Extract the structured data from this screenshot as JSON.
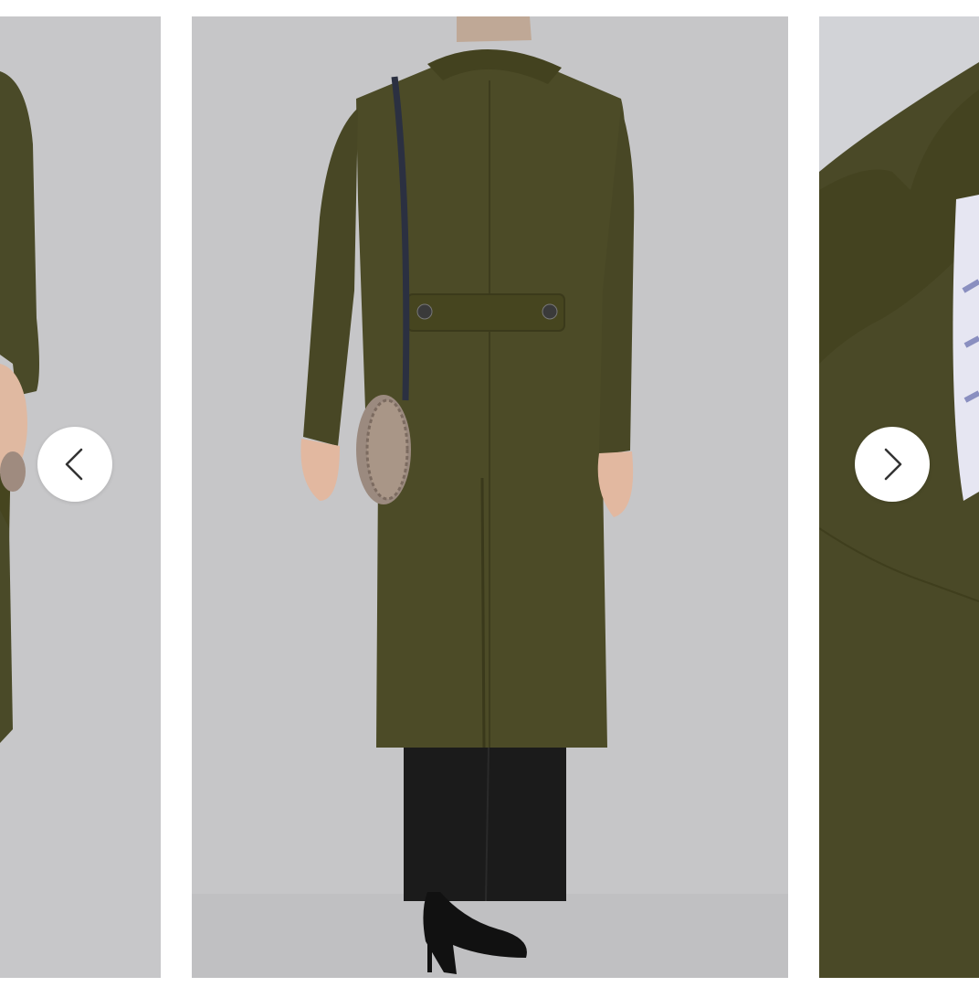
{
  "carousel": {
    "slides": [
      {
        "name": "previous-slide",
        "description_icon": "product-photo"
      },
      {
        "name": "current-slide",
        "description_icon": "product-photo"
      },
      {
        "name": "next-slide",
        "description_icon": "product-photo"
      }
    ],
    "prev_button": {
      "icon": "chevron-left-icon"
    },
    "next_button": {
      "icon": "chevron-right-icon"
    }
  },
  "colors": {
    "background": "#ffffff",
    "coat": "#4b4a28",
    "photo_backdrop": "#c6c6c8",
    "button_bg": "#ffffff",
    "chevron": "#333333"
  }
}
